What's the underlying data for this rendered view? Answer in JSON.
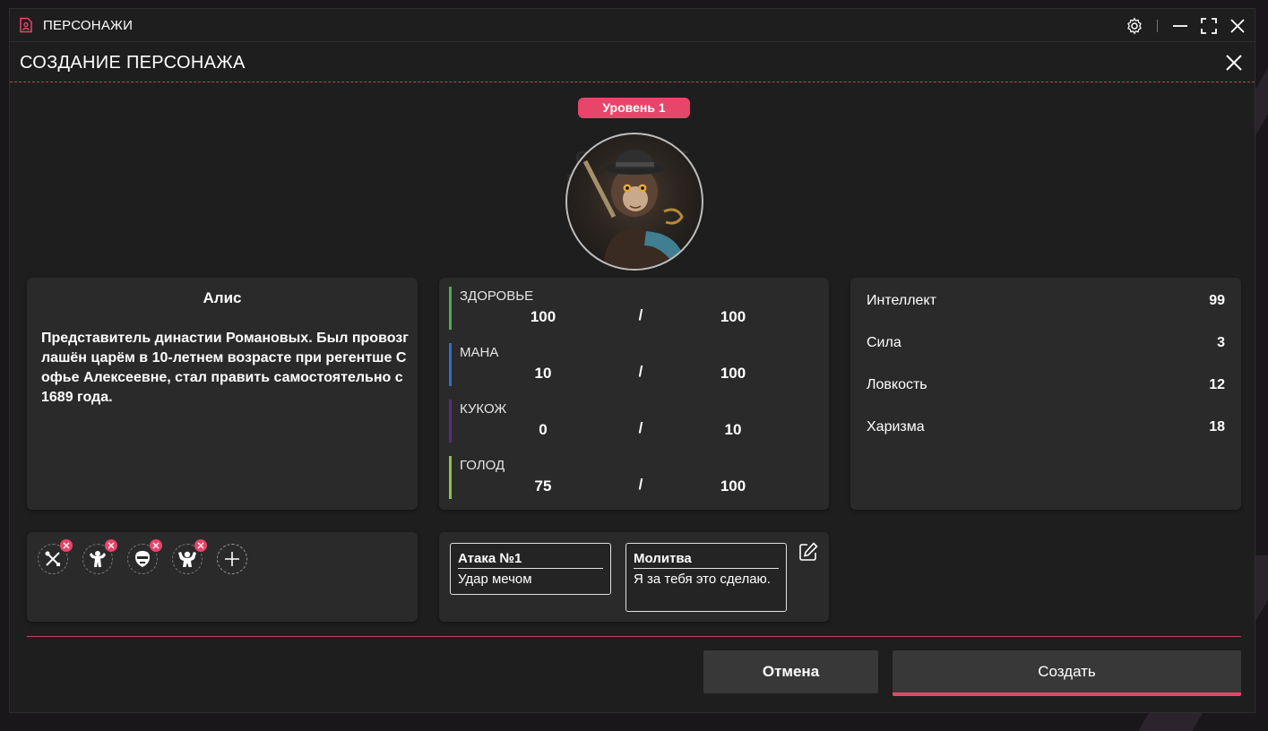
{
  "app": {
    "title": "ПЕРСОНАЖИ"
  },
  "panel": {
    "title": "СОЗДАНИЕ ПЕРСОНАЖА",
    "ghost_title": "СОЗДАНИЕ ПЕРСОНАЖА"
  },
  "character": {
    "level": "Уровень 1",
    "name": "Алис",
    "description": "Представитель династии Романовых. Был провозглашён царём в 10-летнем возрасте при регентше Софье Алексеевне, стал править самостоятельно с 1689 года."
  },
  "resources": [
    {
      "label": "ЗДОРОВЬЕ",
      "current": "100",
      "separator": "/",
      "max": "100",
      "color": "#4caf50"
    },
    {
      "label": "МАНА",
      "current": "10",
      "separator": "/",
      "max": "100",
      "color": "#2f6fc4"
    },
    {
      "label": "КУКОЖ",
      "current": "0",
      "separator": "/",
      "max": "10",
      "color": "#5a2d7a"
    },
    {
      "label": "ГОЛОД",
      "current": "75",
      "separator": "/",
      "max": "100",
      "color": "#8bc34a"
    }
  ],
  "stats": [
    {
      "label": "Интеллект",
      "value": "99"
    },
    {
      "label": "Сила",
      "value": "3"
    },
    {
      "label": "Ловкость",
      "value": "12"
    },
    {
      "label": "Харизма",
      "value": "18"
    }
  ],
  "traits": [
    {
      "icon": "crossed-tools-icon"
    },
    {
      "icon": "strongman-icon"
    },
    {
      "icon": "mask-face-icon"
    },
    {
      "icon": "flexing-figure-icon"
    }
  ],
  "actions": [
    {
      "title": "Атака №1",
      "text": "Удар мечом"
    },
    {
      "title": "Молитва",
      "text": "Я за тебя это сделаю."
    }
  ],
  "buttons": {
    "cancel": "Отмена",
    "create": "Создать"
  },
  "colors": {
    "accent": "#e8456a",
    "background": "#1e1e1e",
    "card": "#2a2a2a"
  }
}
